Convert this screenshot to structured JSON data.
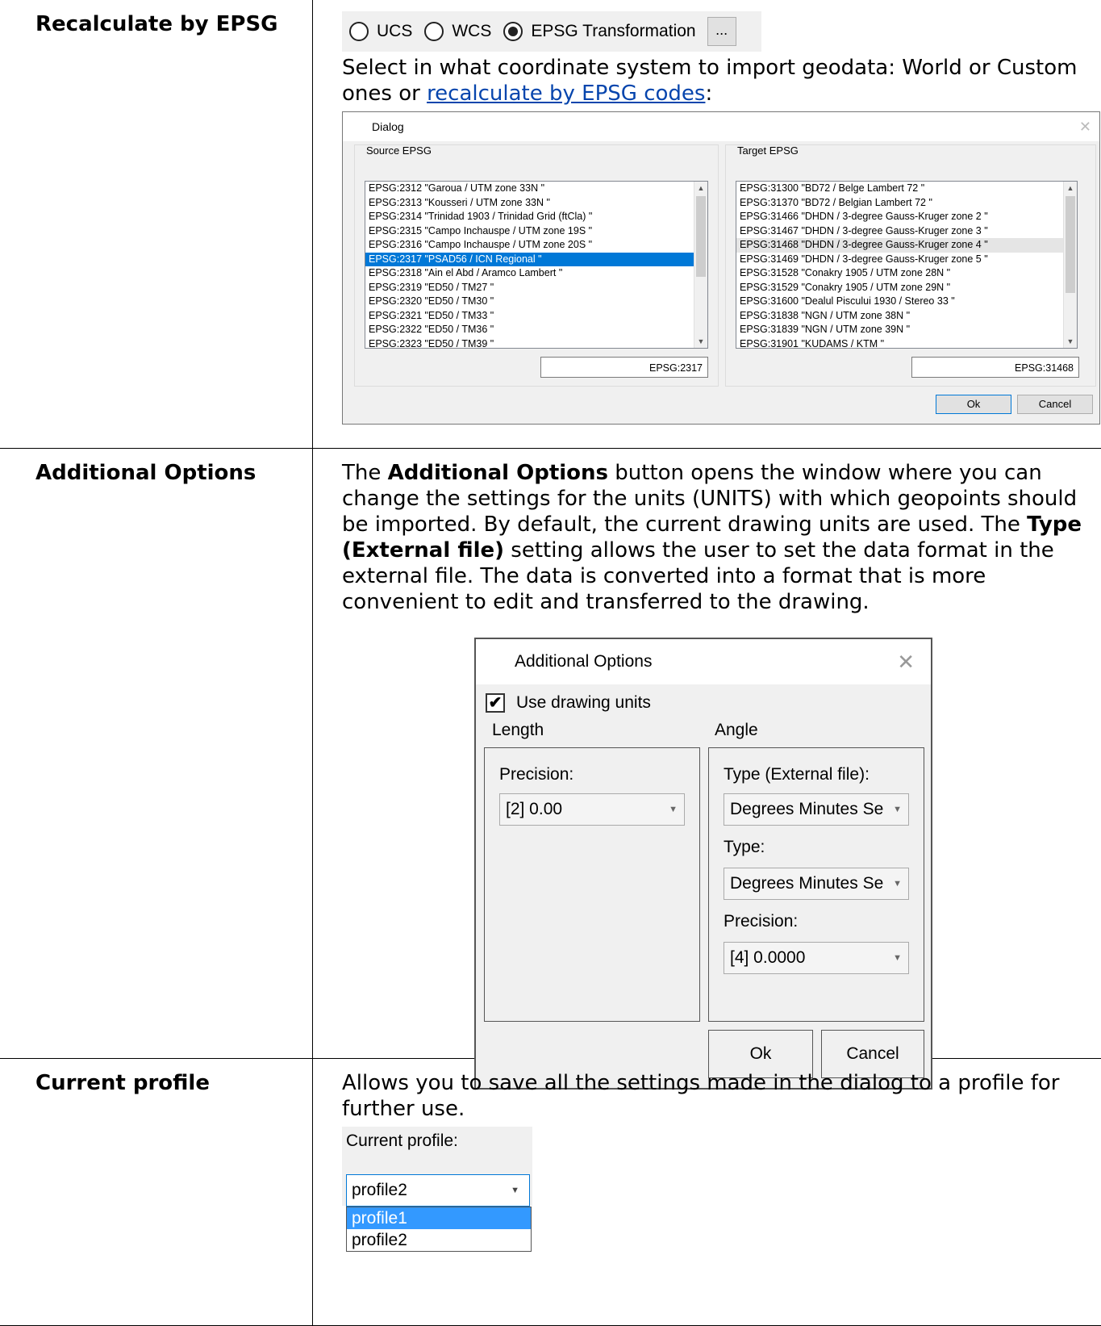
{
  "rows": [
    {
      "term": "Recalculate by EPSG",
      "radio_options": [
        {
          "label": "UCS",
          "selected": false
        },
        {
          "label": "WCS",
          "selected": false
        },
        {
          "label": "EPSG Transformation",
          "selected": true
        }
      ],
      "more_button": "...",
      "text_before_link": "Select in what coordinate system to import geodata: World or Custom ones or ",
      "link_text": "recalculate by EPSG codes",
      "text_after_link": ":",
      "dialog": {
        "title": "Dialog",
        "source_label": "Source EPSG",
        "target_label": "Target EPSG",
        "source_items": [
          "EPSG:2312  \"Garoua / UTM zone 33N \"",
          "EPSG:2313  \"Kousseri / UTM zone 33N \"",
          "EPSG:2314  \"Trinidad 1903 / Trinidad Grid (ftCla) \"",
          "EPSG:2315  \"Campo Inchauspe / UTM zone 19S \"",
          "EPSG:2316  \"Campo Inchauspe / UTM zone 20S \"",
          "EPSG:2317  \"PSAD56 / ICN Regional \"",
          "EPSG:2318  \"Ain el Abd / Aramco Lambert \"",
          "EPSG:2319  \"ED50 / TM27 \"",
          "EPSG:2320  \"ED50 / TM30 \"",
          "EPSG:2321  \"ED50 / TM33 \"",
          "EPSG:2322  \"ED50 / TM36 \"",
          "EPSG:2323  \"ED50 / TM39 \""
        ],
        "source_selected_index": 5,
        "target_items": [
          "EPSG:31300  \"BD72 / Belge Lambert 72 \"",
          "EPSG:31370  \"BD72 / Belgian Lambert 72 \"",
          "EPSG:31466  \"DHDN / 3-degree Gauss-Kruger zone 2 \"",
          "EPSG:31467  \"DHDN / 3-degree Gauss-Kruger zone 3 \"",
          "EPSG:31468  \"DHDN / 3-degree Gauss-Kruger zone 4 \"",
          "EPSG:31469  \"DHDN / 3-degree Gauss-Kruger zone 5 \"",
          "EPSG:31528  \"Conakry 1905 / UTM zone 28N \"",
          "EPSG:31529  \"Conakry 1905 / UTM zone 29N \"",
          "EPSG:31600  \"Dealul Piscului 1930 / Stereo 33 \"",
          "EPSG:31838  \"NGN / UTM zone 38N \"",
          "EPSG:31839  \"NGN / UTM zone 39N \"",
          "EPSG:31901  \"KUDAMS / KTM \""
        ],
        "target_selected_index": 4,
        "source_code": "EPSG:2317",
        "target_code": "EPSG:31468",
        "ok": "Ok",
        "cancel": "Cancel"
      }
    },
    {
      "term": "Additional Options",
      "p1": "The ",
      "b1": "Additional Options",
      "p2": " button opens the window where you can change the settings for the units (UNITS) with which geopoints should be imported. By default, the current drawing units are used. The ",
      "b2": "Type (External file)",
      "p3": " setting allows the user to set the data format in the external file. The data is converted into a format that is more convenient to edit and transferred to the drawing.",
      "dialog": {
        "title": "Additional Options",
        "use_units_label": "Use drawing units",
        "use_units_checked": true,
        "length_label": "Length",
        "angle_label": "Angle",
        "length_precision_label": "Precision:",
        "length_precision_value": "[2] 0.00",
        "angle_ext_type_label": "Type (External file):",
        "angle_ext_type_value": "Degrees Minutes Se",
        "angle_type_label": "Type:",
        "angle_type_value": "Degrees Minutes Se",
        "angle_precision_label": "Precision:",
        "angle_precision_value": "[4] 0.0000",
        "ok": "Ok",
        "cancel": "Cancel"
      }
    },
    {
      "term": "Current profile",
      "text": "Allows you to save all the settings made in the dialog to a profile for further use.",
      "widget": {
        "label": "Current profile:",
        "value": "profile2",
        "options": [
          "profile1",
          "profile2"
        ],
        "highlighted_index": 0
      }
    }
  ]
}
